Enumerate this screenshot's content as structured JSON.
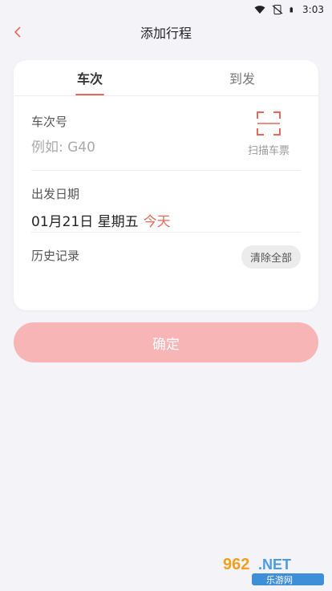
{
  "status_bar": {
    "time": "3:03"
  },
  "header": {
    "title": "添加行程"
  },
  "tabs": [
    {
      "label": "车次"
    },
    {
      "label": "到发"
    }
  ],
  "train_number": {
    "label": "车次号",
    "value": "",
    "placeholder": "例如: G40",
    "scan_label": "扫描车票"
  },
  "departure": {
    "label": "出发日期",
    "date": "01月21日 星期五",
    "today_tag": "今天"
  },
  "history": {
    "label": "历史记录",
    "clear_label": "清除全部"
  },
  "confirm_label": "确定",
  "colors": {
    "accent": "#e36a5a",
    "confirm_bg": "#f7b6b5",
    "page_bg": "#f4f3f8"
  },
  "watermark": {
    "text": "962.NET 乐游网"
  }
}
